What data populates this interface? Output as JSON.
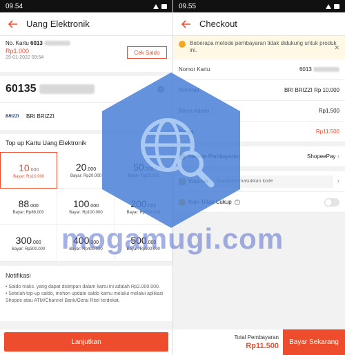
{
  "left": {
    "status": {
      "time": "09.54"
    },
    "header": {
      "title": "Uang Elektronik"
    },
    "card": {
      "label": "No. Kartu",
      "number_prefix": "6013",
      "balance": "Rp1.000",
      "date": "29-01-2022 09:54",
      "cek_saldo": "Cek Saldo"
    },
    "card_input": {
      "number_prefix": "60135"
    },
    "provider": {
      "logo": "BRIZZI",
      "name": "BRI BRIZZI"
    },
    "topup_title": "Top up Kartu Uang Elektronik",
    "options": [
      {
        "main": "10",
        "sub": ".000",
        "price": "Bayar: Rp10.000"
      },
      {
        "main": "20",
        "sub": ".000",
        "price": "Bayar: Rp20.000"
      },
      {
        "main": "50",
        "sub": ".000",
        "price": "Bayar: Rp50.000"
      },
      {
        "main": "88",
        "sub": ".000",
        "price": "Bayar: Rp88.000"
      },
      {
        "main": "100",
        "sub": ".000",
        "price": "Bayar: Rp100.000"
      },
      {
        "main": "200",
        "sub": ".000",
        "price": "Bayar: Rp200.000"
      },
      {
        "main": "300",
        "sub": ".000",
        "price": "Bayar: Rp300.000"
      },
      {
        "main": "400",
        "sub": ".000",
        "price": "Bayar: Rp400.000"
      },
      {
        "main": "500",
        "sub": ".000",
        "price": "Bayar: Rp500.000"
      }
    ],
    "notifikasi": {
      "title": "Notifikasi",
      "line1": "• Saldo maks. yang dapat disimpan dalam kartu ini adalah Rp2.000.000.",
      "line2": "• Setelah top-up saldo, mohon update saldo kamu melalui melalui aplikasi Shopee atau ATM/Channel Bank/Gerai Ritel terdekat."
    },
    "lanjutkan": "Lanjutkan"
  },
  "right": {
    "status": {
      "time": "09.55"
    },
    "header": {
      "title": "Checkout"
    },
    "warning": "Beberapa metode pembayaran tidak didukung untuk produk ini.",
    "rows": {
      "nomor_kartu": {
        "label": "Nomor Kartu",
        "value": "6013"
      },
      "nominal": {
        "label": "Nominal",
        "value": "BRI BRIZZI Rp 10.000"
      },
      "biaya_admin": {
        "label": "Biaya Admin",
        "value": "Rp1.500"
      },
      "harga": {
        "label": "Harga",
        "value": "Rp11.500"
      }
    },
    "metode": {
      "label": "Metode Pembayaran",
      "value": "ShopeePay"
    },
    "voucher": {
      "label": "Voucher",
      "placeholder": "Gunakan/ masukkan kode"
    },
    "koin": {
      "label": "Koin Tidak Cukup"
    },
    "total": {
      "label": "Total Pembayaran",
      "value": "Rp11.500"
    },
    "bayar": "Bayar Sekarang"
  },
  "watermark": "mogamugi.com",
  "colors": {
    "accent": "#ee4d2d",
    "warning_bg": "#fff8e4"
  }
}
